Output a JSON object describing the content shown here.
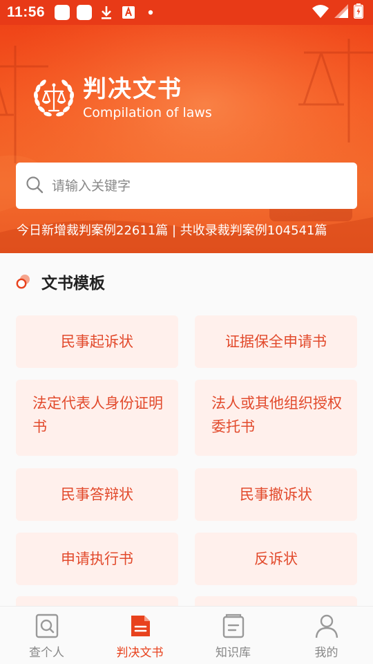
{
  "status_bar": {
    "time": "11:56",
    "notification_icons": [
      "app-notification-icon",
      "app-notification-icon",
      "download-icon",
      "translate-icon",
      "dot-icon"
    ],
    "system_icons": [
      "wifi-icon",
      "signal-icon",
      "battery-charging-icon"
    ]
  },
  "hero": {
    "title": "判决文书",
    "subtitle": "Compilation of laws",
    "emblem_icon": "scales-of-justice-icon",
    "stats_text": "今日新增裁判案例22611篇 | 共收录裁判案例104541篇"
  },
  "search": {
    "placeholder": "请输入关键字",
    "value": ""
  },
  "templates": {
    "title": "文书模板",
    "items": [
      {
        "label": "民事起诉状"
      },
      {
        "label": "证据保全申请书"
      },
      {
        "label": "法定代表人身份证明书"
      },
      {
        "label": "法人或其他组织授权委托书"
      },
      {
        "label": "民事答辩状"
      },
      {
        "label": "民事撤诉状"
      },
      {
        "label": "申请执行书"
      },
      {
        "label": "反诉状"
      }
    ]
  },
  "bottom_nav": {
    "items": [
      {
        "label": "查个人",
        "icon": "search-person-icon",
        "active": false
      },
      {
        "label": "判决文书",
        "icon": "document-icon",
        "active": true
      },
      {
        "label": "知识库",
        "icon": "book-icon",
        "active": false
      },
      {
        "label": "我的",
        "icon": "user-icon",
        "active": false
      }
    ]
  },
  "colors": {
    "accent": "#e8421d",
    "card_background": "#fff0ec",
    "card_text": "#e24a2c"
  }
}
